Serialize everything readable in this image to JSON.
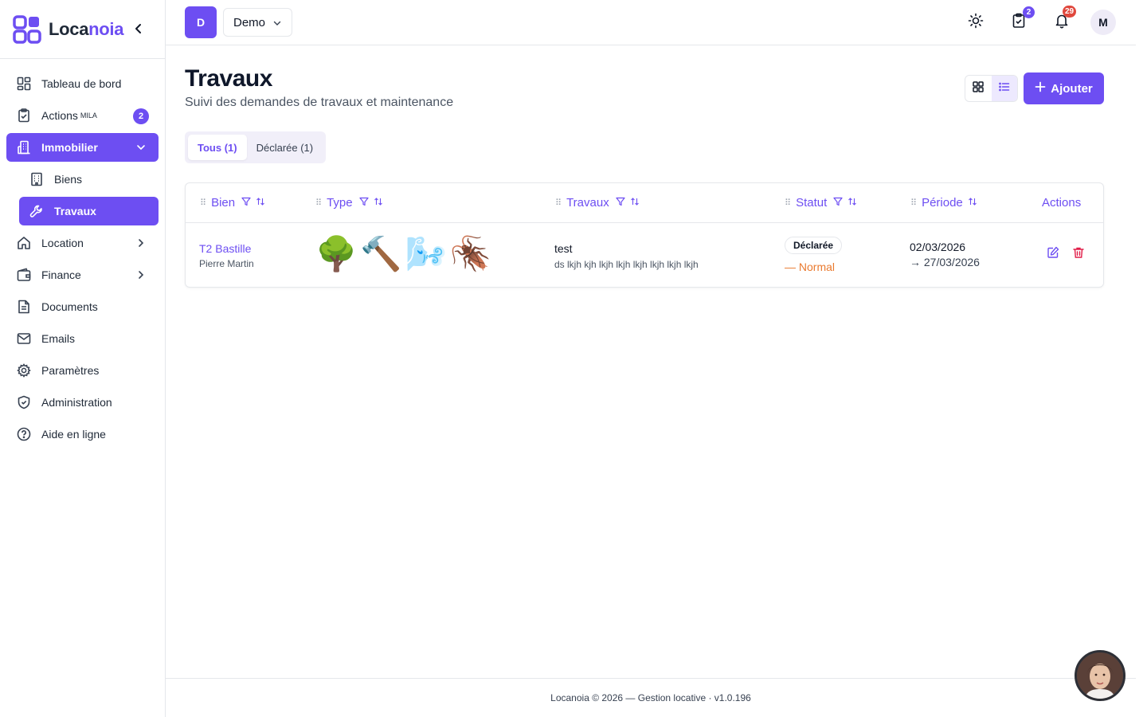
{
  "app": {
    "name_part1": "Loca",
    "name_part2": "noia"
  },
  "colors": {
    "accent": "#6d4ef2",
    "danger": "#e11d48",
    "warning": "#ea7a2f"
  },
  "sidebar": {
    "items": [
      {
        "label": "Tableau de bord",
        "icon": "dashboard-icon"
      },
      {
        "label": "Actions",
        "sup": "MILA",
        "badge": "2",
        "icon": "clipboard-check-icon"
      },
      {
        "label": "Immobilier",
        "icon": "building-icon",
        "active": true,
        "expanded": true
      },
      {
        "label": "Biens",
        "icon": "office-building-icon"
      },
      {
        "label": "Travaux",
        "icon": "wrench-icon",
        "active": true
      },
      {
        "label": "Location",
        "icon": "home-icon"
      },
      {
        "label": "Finance",
        "icon": "wallet-icon"
      },
      {
        "label": "Documents",
        "icon": "document-icon"
      },
      {
        "label": "Emails",
        "icon": "mail-icon"
      },
      {
        "label": "Paramètres",
        "icon": "gear-icon"
      },
      {
        "label": "Administration",
        "icon": "shield-icon"
      },
      {
        "label": "Aide en ligne",
        "icon": "help-icon"
      }
    ]
  },
  "topbar": {
    "org_initial": "D",
    "org_name": "Demo",
    "tasks_badge": "2",
    "notifications_badge": "29",
    "user_initial": "M"
  },
  "main": {
    "title": "Travaux",
    "subtitle": "Suivi des demandes de travaux et maintenance",
    "add_label": "Ajouter",
    "tabs": [
      {
        "label": "Tous (1)",
        "active": true
      },
      {
        "label": "Déclarée (1)",
        "active": false
      }
    ],
    "table": {
      "headers": {
        "bien": "Bien",
        "type": "Type",
        "travaux": "Travaux",
        "statut": "Statut",
        "periode": "Période",
        "actions": "Actions"
      },
      "rows": [
        {
          "bien_name": "T2 Bastille",
          "bien_tenant": "Pierre Martin",
          "types": [
            "🌳",
            "🔨",
            "🌬️",
            "🪳"
          ],
          "travaux_title": "test",
          "travaux_desc": "ds lkjh kjh lkjh lkjh lkjh lkjh lkjh lkjh",
          "statut": "Déclarée",
          "priorite": "— Normal",
          "date_debut": "02/03/2026",
          "date_fin": "→ 27/03/2026"
        }
      ]
    }
  },
  "footer": {
    "text": "Locanoia © 2026 — Gestion locative · v1.0.196"
  }
}
